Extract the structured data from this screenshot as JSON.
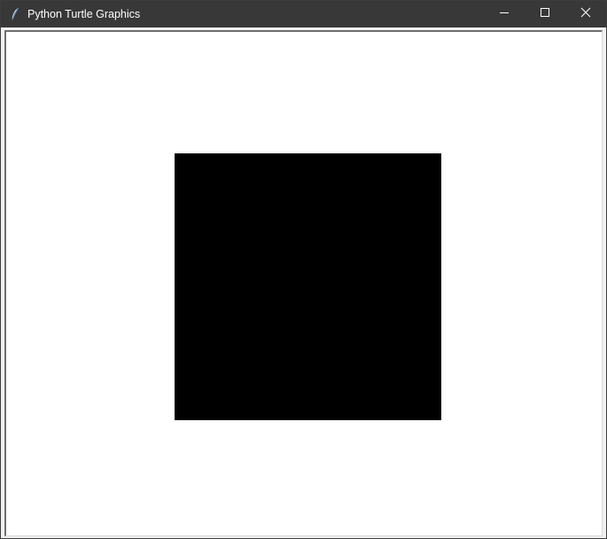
{
  "window": {
    "title": "Python Turtle Graphics",
    "icon": "feather-icon",
    "controls": {
      "minimize_icon": "minimize-icon",
      "maximize_icon": "maximize-icon",
      "close_icon": "close-icon"
    }
  },
  "canvas": {
    "background": "#ffffff",
    "shapes": [
      {
        "type": "filled-square",
        "fill": "#000000"
      }
    ]
  },
  "colors": {
    "titlebar": "#383838",
    "title_text": "#ffffff",
    "frame": "#f0f0f0"
  }
}
